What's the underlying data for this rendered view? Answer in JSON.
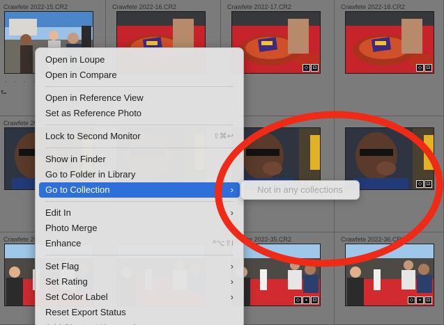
{
  "grid": {
    "cells": [
      {
        "filename": "Crawfete 2022-15.CR2",
        "scene": "crowd",
        "badges": []
      },
      {
        "filename": "Crawfete 2022-16.CR2",
        "scene": "food",
        "badges": []
      },
      {
        "filename": "Crawfete 2022-17.CR2",
        "scene": "food",
        "badges": [
          "tag-icon",
          "crop-icon"
        ]
      },
      {
        "filename": "Crawfete 2022-18.CR2",
        "scene": "food",
        "badges": [
          "tag-icon",
          "crop-icon"
        ]
      },
      {
        "filename": "Crawfete 2022",
        "scene": "man",
        "badges": []
      },
      {
        "filename": "",
        "scene": "man",
        "badges": []
      },
      {
        "filename": "",
        "scene": "man",
        "badges": [
          "tag-icon",
          "crop-icon"
        ]
      },
      {
        "filename": "",
        "scene": "man",
        "badges": [
          "tag-icon",
          "crop-icon"
        ]
      },
      {
        "filename": "Crawfete 2022",
        "scene": "table",
        "badges": []
      },
      {
        "filename": "",
        "scene": "table",
        "badges": []
      },
      {
        "filename": "Crawfete 2022-35.CR2",
        "scene": "table",
        "badges": [
          "tag-icon",
          "flag-icon",
          "crop-icon"
        ]
      },
      {
        "filename": "Crawfete 2022-36.CR2",
        "scene": "table",
        "badges": [
          "tag-icon",
          "flag-icon",
          "crop-icon"
        ]
      }
    ],
    "first_cell_dots": "· · · ·",
    "rotate_glyph": "⮑"
  },
  "menu": {
    "items": [
      {
        "label": "Open in Loupe",
        "shortcut": "",
        "submenu": false
      },
      {
        "label": "Open in Compare",
        "shortcut": "",
        "submenu": false
      },
      {
        "sep": true
      },
      {
        "label": "Open in Reference View",
        "shortcut": "",
        "submenu": false
      },
      {
        "label": "Set as Reference Photo",
        "shortcut": "",
        "submenu": false
      },
      {
        "sep": true
      },
      {
        "label": "Lock to Second Monitor",
        "shortcut": "⇧⌘↩",
        "submenu": false
      },
      {
        "sep": true
      },
      {
        "label": "Show in Finder",
        "shortcut": "",
        "submenu": false
      },
      {
        "label": "Go to Folder in Library",
        "shortcut": "",
        "submenu": false
      },
      {
        "label": "Go to Collection",
        "shortcut": "",
        "submenu": true,
        "highlighted": true
      },
      {
        "sep": true
      },
      {
        "label": "Edit In",
        "shortcut": "",
        "submenu": true
      },
      {
        "label": "Photo Merge",
        "shortcut": "",
        "submenu": true
      },
      {
        "label": "Enhance",
        "shortcut": "^⌥⇧I",
        "submenu": false
      },
      {
        "sep": true
      },
      {
        "label": "Set Flag",
        "shortcut": "",
        "submenu": true
      },
      {
        "label": "Set Rating",
        "shortcut": "",
        "submenu": true
      },
      {
        "label": "Set Color Label",
        "shortcut": "",
        "submenu": true
      },
      {
        "label": "Reset Export Status",
        "shortcut": "",
        "submenu": false
      },
      {
        "label": "Add Shortcut Keyword",
        "shortcut": "",
        "submenu": false,
        "cut": true
      }
    ],
    "chevron": "›"
  },
  "submenu": {
    "label": "Not in any collections"
  },
  "colors": {
    "highlight": "#2e6fd9",
    "annotation": "#ef2a16"
  }
}
